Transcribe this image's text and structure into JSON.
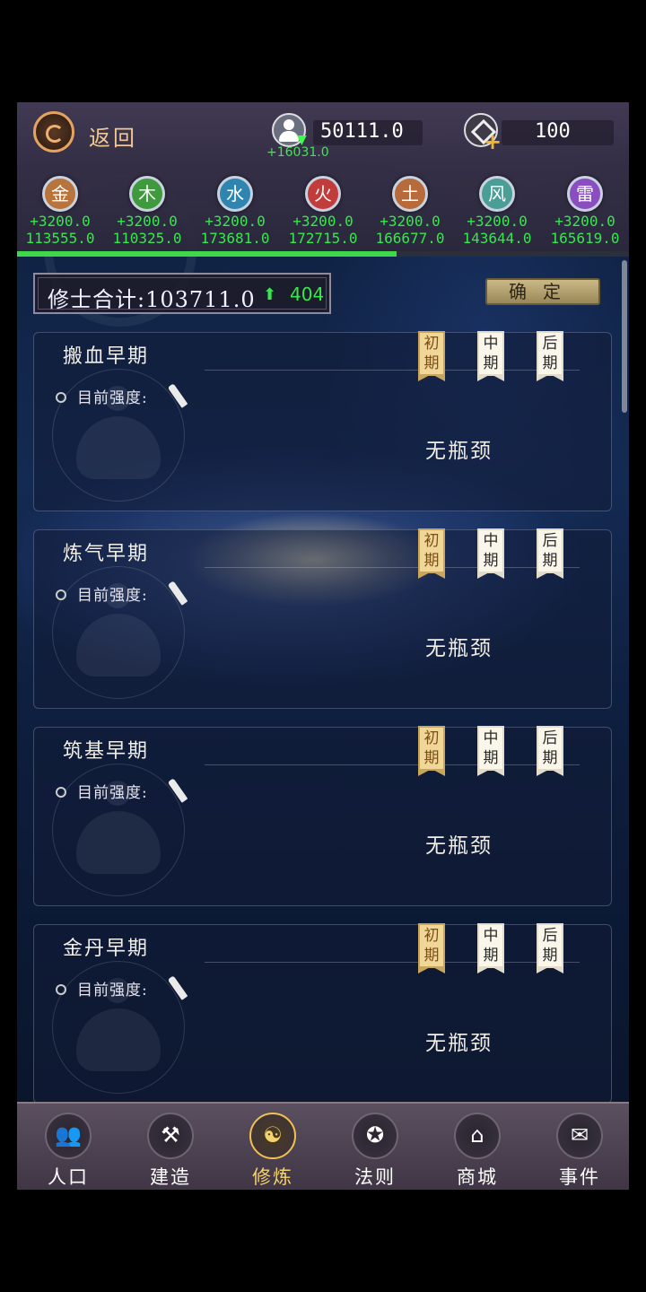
{
  "header": {
    "back_label": "返回",
    "population_value": "50111.0",
    "population_gain": "+16031.0",
    "gems_value": "100"
  },
  "elements": [
    {
      "name": "金",
      "gain": "+3200.0",
      "total": "113555.0",
      "color": "#b8743a"
    },
    {
      "name": "木",
      "gain": "+3200.0",
      "total": "110325.0",
      "color": "#3e9a3c"
    },
    {
      "name": "水",
      "gain": "+3200.0",
      "total": "173681.0",
      "color": "#2e86b0"
    },
    {
      "name": "火",
      "gain": "+3200.0",
      "total": "172715.0",
      "color": "#c23c3c"
    },
    {
      "name": "土",
      "gain": "+3200.0",
      "total": "166677.0",
      "color": "#b86a3a"
    },
    {
      "name": "风",
      "gain": "+3200.0",
      "total": "143644.0",
      "color": "#4a9e96"
    },
    {
      "name": "雷",
      "gain": "+3200.0",
      "total": "165619.0",
      "color": "#8a4ec0"
    }
  ],
  "progress": 0.62,
  "summary": {
    "total_label": "修士合计:103711.0",
    "total_increase": "404",
    "confirm_label": "确定"
  },
  "stage_labels": [
    "初期",
    "中期",
    "后期"
  ],
  "panels": [
    {
      "title": "搬血早期",
      "strength_label": "目前强度:",
      "status": "无瓶颈"
    },
    {
      "title": "炼气早期",
      "strength_label": "目前强度:",
      "status": "无瓶颈"
    },
    {
      "title": "筑基早期",
      "strength_label": "目前强度:",
      "status": "无瓶颈"
    },
    {
      "title": "金丹早期",
      "strength_label": "目前强度:",
      "status": "无瓶颈"
    }
  ],
  "nav": [
    {
      "label": "人口",
      "icon": "people-icon"
    },
    {
      "label": "建造",
      "icon": "hammer-wrench-icon"
    },
    {
      "label": "修炼",
      "icon": "meditation-icon"
    },
    {
      "label": "法则",
      "icon": "rules-banner-icon"
    },
    {
      "label": "商城",
      "icon": "shop-icon"
    },
    {
      "label": "事件",
      "icon": "event-book-icon"
    }
  ],
  "active_nav": "修炼",
  "colors": {
    "green_text": "#35e84b",
    "gold": "#f3c04f"
  }
}
